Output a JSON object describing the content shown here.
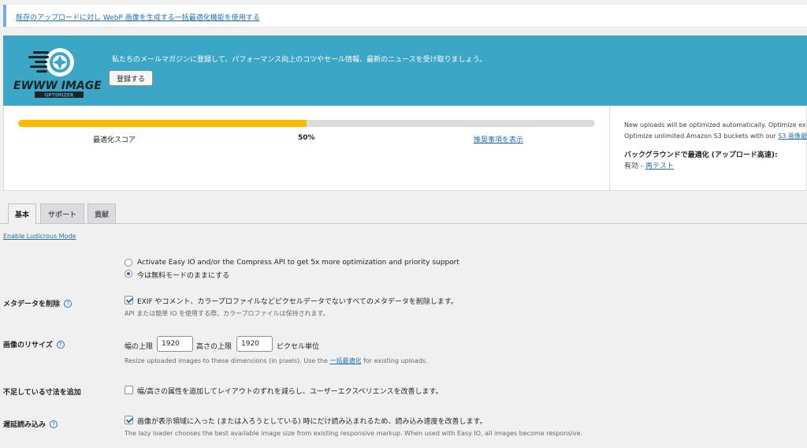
{
  "notice": {
    "link_text": "既存のアップロードに対し WebP 画像を生成する一括最適化機能を使用する"
  },
  "banner": {
    "logo_main": "EWWW IMAGE",
    "logo_sub": "OPTIMIZER",
    "message": "私たちのメールマガジンに登録して、パフォーマンス向上のコツやセール情報、最新のニュースを受け取りましょう。",
    "subscribe_button": "登録する",
    "bg_color": "#3ba6c6"
  },
  "score": {
    "progress_percent": 50,
    "label": "最適化スコア",
    "value": "50%",
    "recommendations_link": "推奨事項を表示",
    "bar_color": "#ffb900"
  },
  "side": {
    "line1": "New uploads will be optimized automatically. Optimize ex",
    "line2_prefix": "Optimize unlimited Amazon S3 buckets with our",
    "line2_link": "S3 画像最",
    "background_title": "バックグラウンドで最適化 (アップロード高速):",
    "status_prefix": "有効 -",
    "retest_link": "再テスト"
  },
  "tabs": [
    {
      "label": "基本",
      "active": true
    },
    {
      "label": "サポート",
      "active": false
    },
    {
      "label": "貢献",
      "active": false
    }
  ],
  "ludicrous_link": "Enable Ludicrous Mode",
  "settings": {
    "mode_option_1": "Activate Easy IO and/or the Compress API to get 5x more optimization and priority support",
    "mode_option_2": "今は無料モードのままにする",
    "metadata": {
      "label": "メタデータを削除",
      "option": "EXIF やコメント、カラープロファイルなどピクセルデータでないすべてのメタデータを削除します。",
      "desc": "API または簡単 IO を使用する際、カラープロファイルは保持されます。",
      "checked": true
    },
    "resize": {
      "label": "画像のリサイズ",
      "width_label": "幅の上限",
      "width_value": "1920",
      "height_label": "高さの上限",
      "height_value": "1920",
      "unit": "ピクセル単位",
      "desc_prefix": "Resize uploaded images to these dimensions (in pixels). Use the",
      "desc_link": "一括最適化",
      "desc_suffix": "for existing uploads."
    },
    "dimensions": {
      "label": "不足している寸法を追加",
      "option": "幅/高さの属性を追加してレイアウトのずれを減らし、ユーザーエクスペリエンスを改善します。",
      "checked": false
    },
    "lazy": {
      "label": "遅延読み込み",
      "option": "画像が表示領域に入った (または入ろうとしている) 時にだけ読み込まれるため、読み込み速度を改善します。",
      "desc": "The lazy loader chooses the best available image size from existing responsive markup. When used with Easy IO, all images become responsive.",
      "checked": true
    }
  },
  "help_glyph": "?"
}
